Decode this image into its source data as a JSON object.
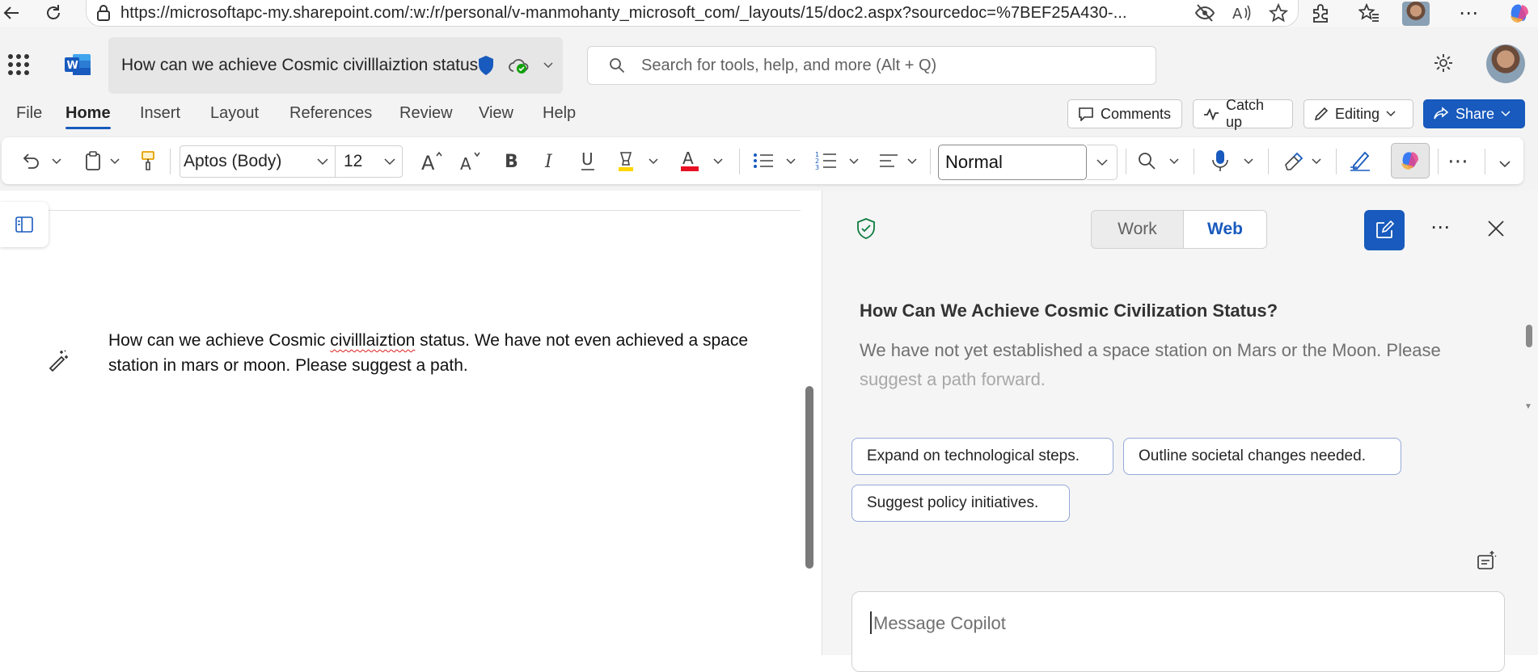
{
  "browser": {
    "url": "https://microsoftapc-my.sharepoint.com/:w:/r/personal/v-manmohanty_microsoft_com/_layouts/15/doc2.aspx?sourcedoc=%7BEF25A430-..."
  },
  "header": {
    "doc_title": "How can we achieve Cosmic civilllaiztion status",
    "search_placeholder": "Search for tools, help, and more (Alt + Q)"
  },
  "menu": {
    "tabs": [
      {
        "label": "File"
      },
      {
        "label": "Home",
        "active": true
      },
      {
        "label": "Insert"
      },
      {
        "label": "Layout"
      },
      {
        "label": "References"
      },
      {
        "label": "Review"
      },
      {
        "label": "View"
      },
      {
        "label": "Help"
      }
    ],
    "comments_label": "Comments",
    "catchup_label": "Catch up",
    "editing_label": "Editing",
    "share_label": "Share"
  },
  "ribbon": {
    "font_name": "Aptos (Body)",
    "font_size": "12",
    "style_name": "Normal",
    "font_color": "#e81123"
  },
  "document": {
    "line1_before": "How can we achieve Cosmic ",
    "line1_misspelled": "civilllaiztion",
    "line1_after": " status. We have not even achieved a space",
    "line2": "station in mars or moon. Please suggest a path."
  },
  "copilot": {
    "toggle_work": "Work",
    "toggle_web": "Web",
    "heading": "How Can We Achieve Cosmic Civilization Status?",
    "body_line1": "We have not yet established a space station on Mars or the Moon. Please",
    "body_line2": "suggest a path forward.",
    "chips": [
      "Expand on technological steps.",
      "Outline societal changes needed.",
      "Suggest policy initiatives."
    ],
    "message_placeholder": "Message Copilot"
  },
  "colors": {
    "accent": "#185abd",
    "shield_green": "#0f7b3f",
    "spell_error": "#e02020"
  }
}
